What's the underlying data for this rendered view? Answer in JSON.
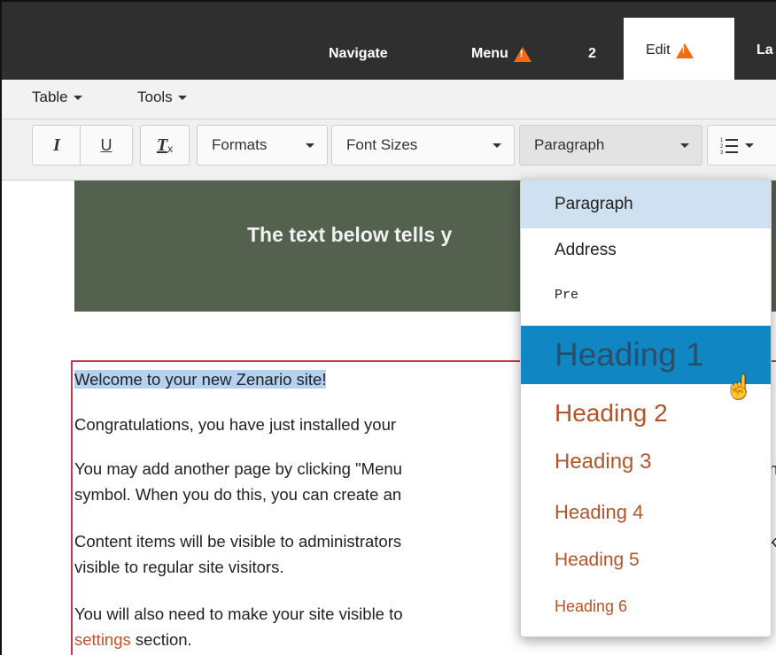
{
  "adminbar": {
    "navigate": "Navigate",
    "menu": "Menu",
    "count": "2",
    "edit": "Edit",
    "cut_tab": "La"
  },
  "menubar": {
    "table": "Table",
    "tools": "Tools"
  },
  "toolbar": {
    "italic": "I",
    "underline": "U",
    "clear": "T",
    "clear_sub": "x",
    "formats": "Formats",
    "font_sizes": "Font Sizes",
    "paragraph": "Paragraph",
    "list_icon": "numbered-list-icon"
  },
  "hero": {
    "text": "The text below tells y"
  },
  "content": {
    "p1": "Welcome to your new Zenario site!",
    "p2": "Congratulations, you have just installed your",
    "p3a": "You may add another page by clicking \"Menu",
    "p3b": "symbol. When you do this, you can create an",
    "p4a": "Content items will be visible to administrators",
    "p4b": "visible to regular site visitors.",
    "p5a": "You will also need to make your site visible to",
    "p5b_link": "settings",
    "p5b_rest": " section.",
    "right_h": "h",
    "right_k": "k"
  },
  "dropdown": {
    "items": [
      "Paragraph",
      "Address",
      "Pre",
      "Heading 1",
      "Heading 2",
      "Heading 3",
      "Heading 4",
      "Heading 5",
      "Heading 6"
    ]
  },
  "colors": {
    "accent_highlight": "#1086c2",
    "heading": "#b3542b",
    "warning": "#f26b10"
  }
}
